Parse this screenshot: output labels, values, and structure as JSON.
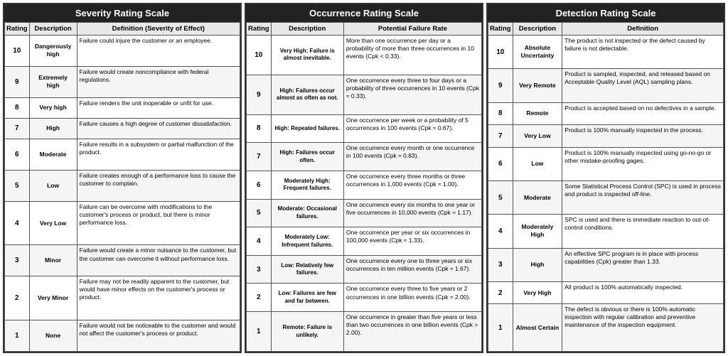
{
  "severity": {
    "title": "Severity Rating Scale",
    "columns": [
      "Rating",
      "Description",
      "Definition (Severity of Effect)"
    ],
    "rows": [
      {
        "rating": "10",
        "desc": "Dangerously high",
        "def": "Failure could injure the customer or an employee."
      },
      {
        "rating": "9",
        "desc": "Extremely high",
        "def": "Failure would create noncompliance with federal regulations."
      },
      {
        "rating": "8",
        "desc": "Very high",
        "def": "Failure renders the unit inoperable or unfit for use."
      },
      {
        "rating": "7",
        "desc": "High",
        "def": "Failure causes a high degree of customer dissatisfaction."
      },
      {
        "rating": "6",
        "desc": "Moderate",
        "def": "Failure results in a subsystem or partial malfunction of the product."
      },
      {
        "rating": "5",
        "desc": "Low",
        "def": "Failure creates enough of a performance loss to cause the customer to complain."
      },
      {
        "rating": "4",
        "desc": "Very Low",
        "def": "Failure can be overcome with modifications to the customer's process or product, but there is minor performance loss."
      },
      {
        "rating": "3",
        "desc": "Minor",
        "def": "Failure would create a minor nuisance to the customer, but the customer can overcome it without performance loss."
      },
      {
        "rating": "2",
        "desc": "Very Minor",
        "def": "Failure may not be readily apparent to the customer, but would have minor effects on the customer's process or product."
      },
      {
        "rating": "1",
        "desc": "None",
        "def": "Failure would not be noticeable to the customer and would not affect the customer's process or product."
      }
    ]
  },
  "occurrence": {
    "title": "Occurrence Rating Scale",
    "columns": [
      "Rating",
      "Description",
      "Potential Failure Rate"
    ],
    "rows": [
      {
        "rating": "10",
        "desc": "Very High: Failure is almost inevitable.",
        "def": "More than one occurrence per day or a probability of more than three occurrences in 10 events (Cpk < 0.33)."
      },
      {
        "rating": "9",
        "desc": "High: Failures occur almost as often as not.",
        "def": "One occurrence every three to four days or a probability of three occurrences in 10 events (Cpk ≈ 0.33)."
      },
      {
        "rating": "8",
        "desc": "High: Repeated failures.",
        "def": "One occurrence per week or a probability of 5 occurrences in 100 events (Cpk ≈ 0.67)."
      },
      {
        "rating": "7",
        "desc": "High: Failures occur often.",
        "def": "One occurrence every month or one occurrence in 100 events (Cpk ≈ 0.83)."
      },
      {
        "rating": "6",
        "desc": "Moderately High: Frequent failures.",
        "def": "One occurrence every three months or three occurrences in 1,000 events (Cpk ≈ 1.00)."
      },
      {
        "rating": "5",
        "desc": "Moderate: Occasional failures.",
        "def": "One occurrence every six months to one year or five occurrences in 10,000 events (Cpk ≈ 1.17)."
      },
      {
        "rating": "4",
        "desc": "Moderately Low: Infrequent failures.",
        "def": "One occurrence per year or six occurrences in 100,000 events (Cpk ≈ 1.33)."
      },
      {
        "rating": "3",
        "desc": "Low: Relatively few failures.",
        "def": "One occurrence every one to three years or six occurrences in ten million events (Cpk ≈ 1.67)."
      },
      {
        "rating": "2",
        "desc": "Low: Failures are few and far between.",
        "def": "One occurrence every three to five years or 2 occurrences in one billion events (Cpk ≈ 2.00)."
      },
      {
        "rating": "1",
        "desc": "Remote: Failure is unlikely.",
        "def": "One occurrence in greater than five years or less than two occurrences in one billion events (Cpk > 2.00)."
      }
    ]
  },
  "detection": {
    "title": "Detection Rating Scale",
    "columns": [
      "Rating",
      "Description",
      "Definition"
    ],
    "rows": [
      {
        "rating": "10",
        "desc": "Absolute Uncertainty",
        "def": "The product is not inspected or the defect caused by failure is not detectable."
      },
      {
        "rating": "9",
        "desc": "Very Remote",
        "def": "Product is sampled, inspected, and released based on Acceptable Quality Level (AQL) sampling plans."
      },
      {
        "rating": "8",
        "desc": "Remote",
        "def": "Product is accepted based on no defectives in a sample."
      },
      {
        "rating": "7",
        "desc": "Very Low",
        "def": "Product is 100% manually inspected in the process."
      },
      {
        "rating": "6",
        "desc": "Low",
        "def": "Product is 100% manually inspected using go-no-go or other mistake-proofing gages."
      },
      {
        "rating": "5",
        "desc": "Moderate",
        "def": "Some Statistical Process Control (SPC) is used in process and product is inspected off-line."
      },
      {
        "rating": "4",
        "desc": "Moderately High",
        "def": "SPC is used and there is immediate reaction to out-of-control conditions."
      },
      {
        "rating": "3",
        "desc": "High",
        "def": "An effective SPC program is in place with process capabilities (Cpk) greater than 1.33."
      },
      {
        "rating": "2",
        "desc": "Very High",
        "def": "All product is 100% automatically inspected."
      },
      {
        "rating": "1",
        "desc": "Almost Certain",
        "def": "The defect is obvious or there is 100% automatic inspection with regular calibration and preventive maintenance of the inspection equipment."
      }
    ]
  }
}
